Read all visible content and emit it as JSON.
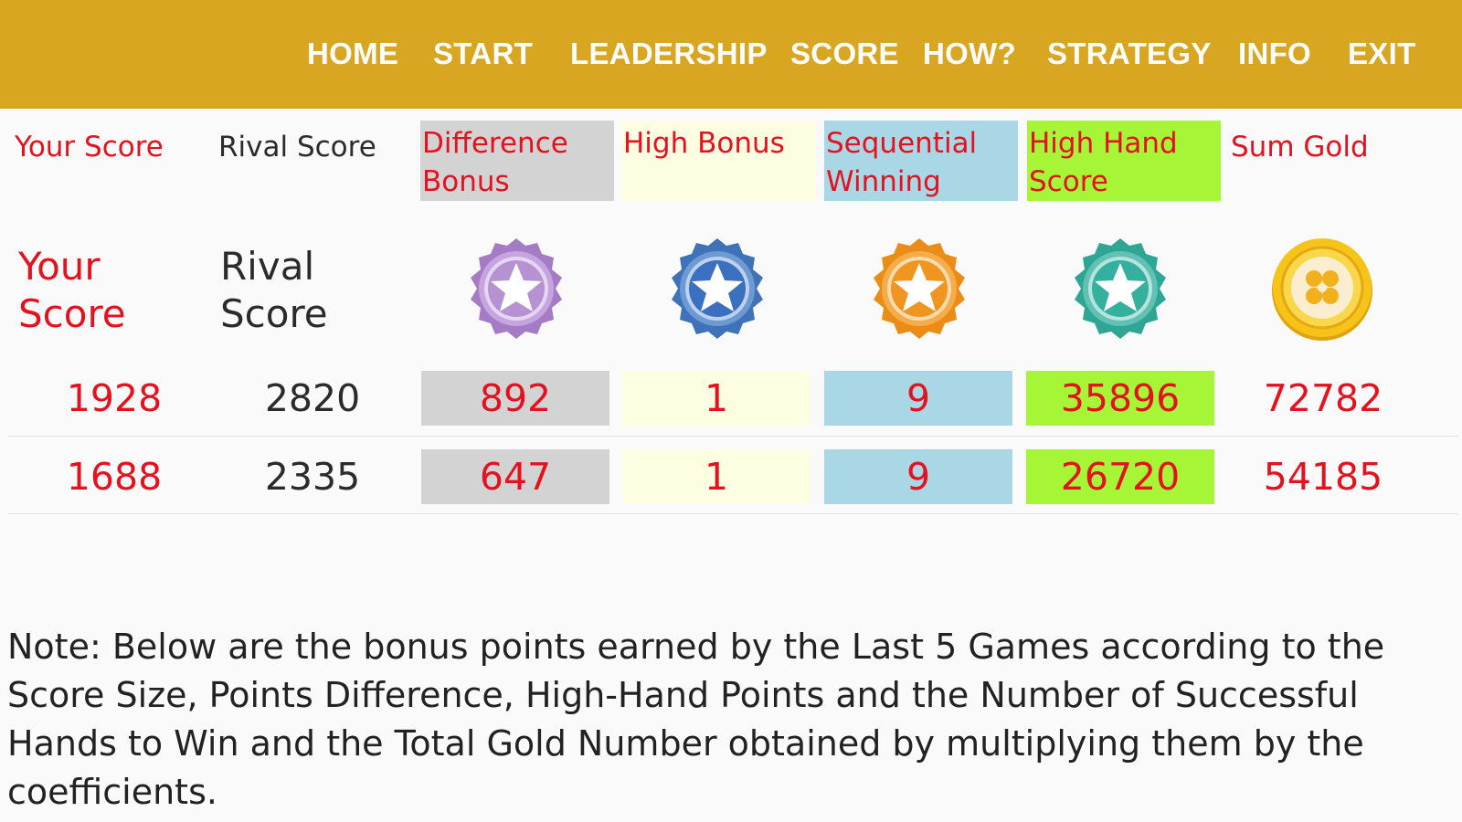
{
  "nav": {
    "items": [
      "HOME",
      "START",
      "LEADERSHIP",
      "SCORE",
      "HOW?",
      "STRATEGY",
      "INFO",
      "EXIT"
    ]
  },
  "headers": {
    "your_score": "Your Score",
    "rival_score": "Rival Score",
    "difference_bonus": "Difference Bonus",
    "high_bonus": "High Bonus",
    "sequential_winning": "Sequential Winning",
    "high_hand_score": "High Hand Score",
    "sum_gold": "Sum Gold"
  },
  "labels": {
    "your_line1": "Your",
    "your_line2": "Score",
    "rival_line1": "Rival",
    "rival_line2": "Score"
  },
  "icons": [
    "purple-star-badge-icon",
    "blue-star-badge-icon",
    "orange-star-badge-icon",
    "teal-star-badge-icon",
    "gold-coin-icon"
  ],
  "colors": {
    "nav_bar": "#d9a621",
    "accent_red": "#e3121e",
    "difference_bg": "#d3d3d3",
    "high_bonus_bg": "#fdfde2",
    "sequential_bg": "#aad7e6",
    "high_hand_bg": "#a6f537"
  },
  "rows": [
    {
      "your": "1928",
      "rival": "2820",
      "difference": "892",
      "high_bonus": "1",
      "sequential": "9",
      "high_hand": "35896",
      "sum_gold": "72782"
    },
    {
      "your": "1688",
      "rival": "2335",
      "difference": "647",
      "high_bonus": "1",
      "sequential": "9",
      "high_hand": "26720",
      "sum_gold": "54185"
    }
  ],
  "note": "Note: Below are the bonus points earned by the Last 5 Games according to the Score Size, Points Difference, High-Hand Points and the Number of Successful Hands to Win and the Total Gold Number obtained by multiplying them by the coefficients."
}
